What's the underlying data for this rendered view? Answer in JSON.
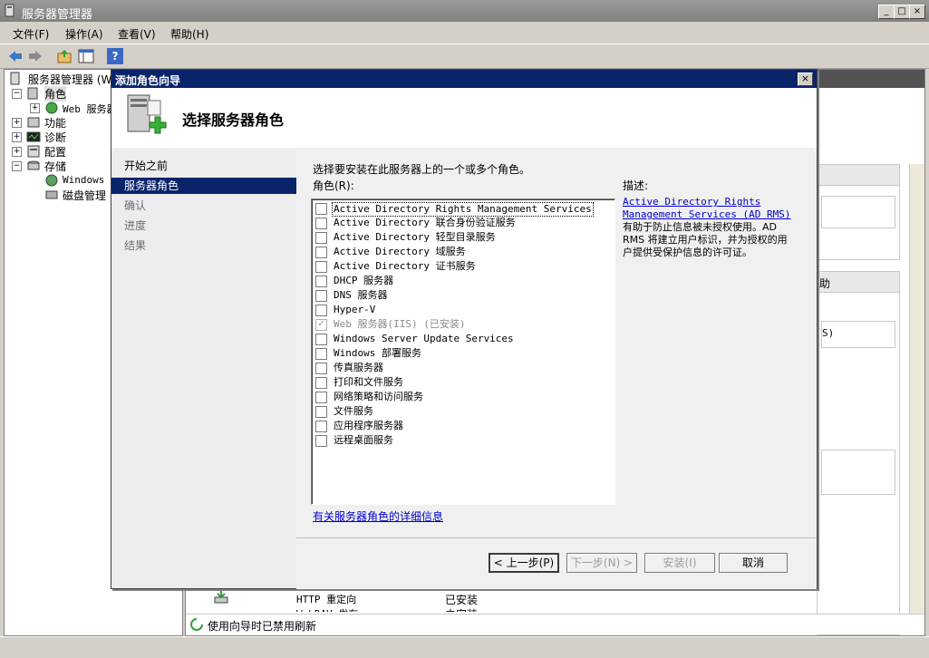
{
  "window": {
    "title": "服务器管理器",
    "btn_min": "_",
    "btn_max": "□",
    "btn_close": "×"
  },
  "menu": {
    "file": "文件(F)",
    "action": "操作(A)",
    "view": "查看(V)",
    "help": "帮助(H)"
  },
  "toolbar": {
    "help_glyph": "?"
  },
  "tree": {
    "root": "服务器管理器 (W",
    "roles": "角色",
    "web_server": "Web 服务器",
    "features": "功能",
    "diagnostics": "诊断",
    "config": "配置",
    "storage": "存储",
    "wsb": "Windows S",
    "disk": "磁盘管理",
    "expand": "+",
    "collapse": "−"
  },
  "right_panel": {
    "help_fragment": "助",
    "s_fragment": "S)",
    "rows": [
      {
        "name": "HTTP 重定向",
        "status": "已安装"
      },
      {
        "name": "WebDAV 发布",
        "status": "未安装"
      }
    ]
  },
  "statusbar": {
    "text": "使用向导时已禁用刷新"
  },
  "dialog": {
    "title": "添加角色向导",
    "close": "×",
    "header": "选择服务器角色",
    "nav": [
      "开始之前",
      "服务器角色",
      "确认",
      "进度",
      "结果"
    ],
    "instruction": "选择要安装在此服务器上的一个或多个角色。",
    "roles_label": "角色(R):",
    "desc_label": "描述:",
    "desc_link": "Active Directory Rights Management Services (AD RMS)",
    "desc_text": "有助于防止信息被未授权使用。AD RMS 将建立用户标识，并为授权的用户提供受保护信息的许可证。",
    "roles": [
      {
        "label": "Active Directory Rights Management Services",
        "checked": false,
        "disabled": false
      },
      {
        "label": "Active Directory 联合身份验证服务",
        "checked": false,
        "disabled": false
      },
      {
        "label": "Active Directory 轻型目录服务",
        "checked": false,
        "disabled": false
      },
      {
        "label": "Active Directory 域服务",
        "checked": false,
        "disabled": false
      },
      {
        "label": "Active Directory 证书服务",
        "checked": false,
        "disabled": false
      },
      {
        "label": "DHCP 服务器",
        "checked": false,
        "disabled": false
      },
      {
        "label": "DNS 服务器",
        "checked": false,
        "disabled": false
      },
      {
        "label": "Hyper-V",
        "checked": false,
        "disabled": false
      },
      {
        "label": "Web 服务器(IIS)  (已安装)",
        "checked": true,
        "disabled": true
      },
      {
        "label": "Windows Server Update Services",
        "checked": false,
        "disabled": false
      },
      {
        "label": "Windows 部署服务",
        "checked": false,
        "disabled": false
      },
      {
        "label": "传真服务器",
        "checked": false,
        "disabled": false
      },
      {
        "label": "打印和文件服务",
        "checked": false,
        "disabled": false
      },
      {
        "label": "网络策略和访问服务",
        "checked": false,
        "disabled": false
      },
      {
        "label": "文件服务",
        "checked": false,
        "disabled": false
      },
      {
        "label": "应用程序服务器",
        "checked": false,
        "disabled": false
      },
      {
        "label": "远程桌面服务",
        "checked": false,
        "disabled": false
      }
    ],
    "more_info": "有关服务器角色的详细信息",
    "buttons": {
      "back": "< 上一步(P)",
      "next": "下一步(N) >",
      "install": "安装(I)",
      "cancel": "取消"
    }
  }
}
